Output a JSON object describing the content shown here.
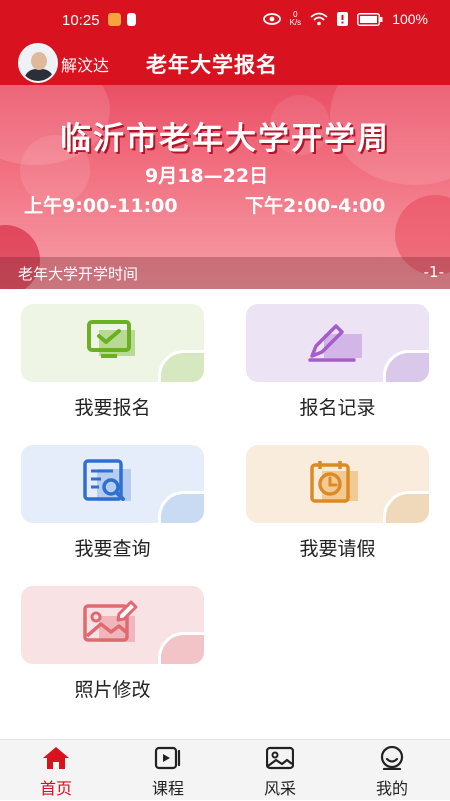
{
  "status_bar": {
    "time": "10:25",
    "network_speed_top": "0",
    "network_speed_unit": "K/s",
    "battery": "100%"
  },
  "header": {
    "username": "解汶达",
    "title": "老年大学报名"
  },
  "banner": {
    "headline": "临沂市老年大学开学周",
    "date": "9月18—22日",
    "morning": "上午9:00-11:00",
    "afternoon": "下午2:00-4:00",
    "caption": "老年大学开学时间",
    "index": "-1-"
  },
  "menu": {
    "items": [
      {
        "label": "我要报名",
        "icon": "monitor-check-icon",
        "bg": "#eef5e4",
        "accent": "#6bb022",
        "corner": "#d5e8c0"
      },
      {
        "label": "报名记录",
        "icon": "pencil-record-icon",
        "bg": "#ece3f4",
        "accent": "#a45dc9",
        "corner": "#dac8ea"
      },
      {
        "label": "我要查询",
        "icon": "search-document-icon",
        "bg": "#e4edf9",
        "accent": "#2f6fd0",
        "corner": "#c9dbf3"
      },
      {
        "label": "我要请假",
        "icon": "calendar-clock-icon",
        "bg": "#f9ecdc",
        "accent": "#dd8a25",
        "corner": "#f0d9bb"
      },
      {
        "label": "照片修改",
        "icon": "photo-edit-icon",
        "bg": "#f9e2e4",
        "accent": "#e06a72",
        "corner": "#f2c4c8"
      }
    ]
  },
  "tabs": [
    {
      "label": "首页",
      "icon": "home-icon",
      "active": true
    },
    {
      "label": "课程",
      "icon": "video-icon",
      "active": false
    },
    {
      "label": "风采",
      "icon": "image-icon",
      "active": false
    },
    {
      "label": "我的",
      "icon": "profile-icon",
      "active": false
    }
  ],
  "colors": {
    "brand": "#d9121f",
    "tab_active": "#d9121f"
  }
}
